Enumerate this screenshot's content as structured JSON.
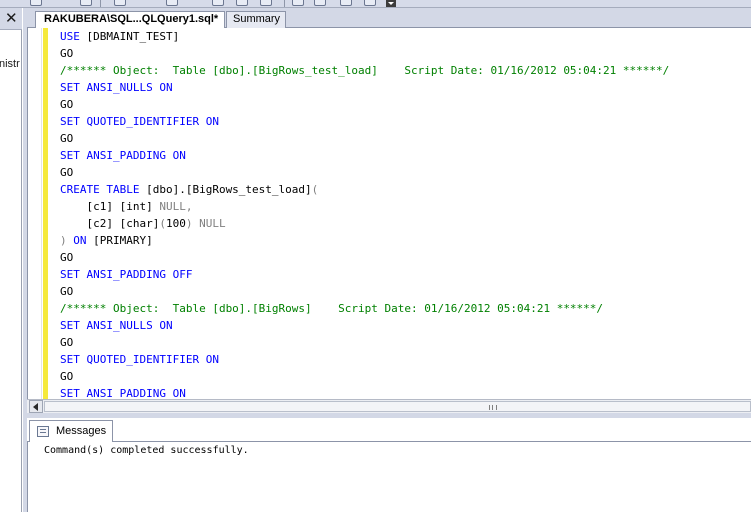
{
  "left_panel": {
    "close_glyph": "✕",
    "partial_text": "nistr"
  },
  "tabs": [
    {
      "label": "RAKUBERA\\SQL...QLQuery1.sql*",
      "active": true
    },
    {
      "label": "Summary",
      "active": false
    }
  ],
  "editor": {
    "lines": [
      [
        {
          "t": "USE ",
          "c": "kw"
        },
        {
          "t": "[DBMAINT_TEST]",
          "c": "tx"
        }
      ],
      [
        {
          "t": "GO",
          "c": "tx"
        }
      ],
      [
        {
          "t": "/****** Object:  Table [dbo].[BigRows_test_load]    Script Date: 01/16/2012 05:04:21 ******/",
          "c": "cm"
        }
      ],
      [
        {
          "t": "SET ",
          "c": "kw"
        },
        {
          "t": "ANSI_NULLS ",
          "c": "kw"
        },
        {
          "t": "ON",
          "c": "kw"
        }
      ],
      [
        {
          "t": "GO",
          "c": "tx"
        }
      ],
      [
        {
          "t": "SET ",
          "c": "kw"
        },
        {
          "t": "QUOTED_IDENTIFIER ",
          "c": "kw"
        },
        {
          "t": "ON",
          "c": "kw"
        }
      ],
      [
        {
          "t": "GO",
          "c": "tx"
        }
      ],
      [
        {
          "t": "SET ",
          "c": "kw"
        },
        {
          "t": "ANSI_PADDING ",
          "c": "kw"
        },
        {
          "t": "ON",
          "c": "kw"
        }
      ],
      [
        {
          "t": "GO",
          "c": "tx"
        }
      ],
      [
        {
          "t": "CREATE TABLE ",
          "c": "kw"
        },
        {
          "t": "[dbo].[BigRows_test_load]",
          "c": "tx"
        },
        {
          "t": "(",
          "c": "gr"
        }
      ],
      [
        {
          "t": "    [c1] [int] ",
          "c": "tx"
        },
        {
          "t": "NULL,",
          "c": "gr"
        }
      ],
      [
        {
          "t": "    [c2] [char]",
          "c": "tx"
        },
        {
          "t": "(",
          "c": "gr"
        },
        {
          "t": "100",
          "c": "tx"
        },
        {
          "t": ") NULL",
          "c": "gr"
        }
      ],
      [
        {
          "t": ") ",
          "c": "gr"
        },
        {
          "t": "ON ",
          "c": "kw"
        },
        {
          "t": "[PRIMARY]",
          "c": "tx"
        }
      ],
      [
        {
          "t": "GO",
          "c": "tx"
        }
      ],
      [
        {
          "t": "SET ",
          "c": "kw"
        },
        {
          "t": "ANSI_PADDING ",
          "c": "kw"
        },
        {
          "t": "OFF",
          "c": "kw"
        }
      ],
      [
        {
          "t": "GO",
          "c": "tx"
        }
      ],
      [
        {
          "t": "/****** Object:  Table [dbo].[BigRows]    Script Date: 01/16/2012 05:04:21 ******/",
          "c": "cm"
        }
      ],
      [
        {
          "t": "SET ",
          "c": "kw"
        },
        {
          "t": "ANSI_NULLS ",
          "c": "kw"
        },
        {
          "t": "ON",
          "c": "kw"
        }
      ],
      [
        {
          "t": "GO",
          "c": "tx"
        }
      ],
      [
        {
          "t": "SET ",
          "c": "kw"
        },
        {
          "t": "QUOTED_IDENTIFIER ",
          "c": "kw"
        },
        {
          "t": "ON",
          "c": "kw"
        }
      ],
      [
        {
          "t": "GO",
          "c": "tx"
        }
      ],
      [
        {
          "t": "SET ",
          "c": "kw"
        },
        {
          "t": "ANSI_PADDING ",
          "c": "kw"
        },
        {
          "t": "ON",
          "c": "kw"
        }
      ]
    ],
    "colors": {
      "keyword": "#0000ff",
      "comment": "#008000",
      "gray": "#808080",
      "text": "#000000",
      "change_bar": "#f5e93c"
    }
  },
  "results": {
    "tab_label": "Messages",
    "message": "Command(s) completed successfully."
  }
}
